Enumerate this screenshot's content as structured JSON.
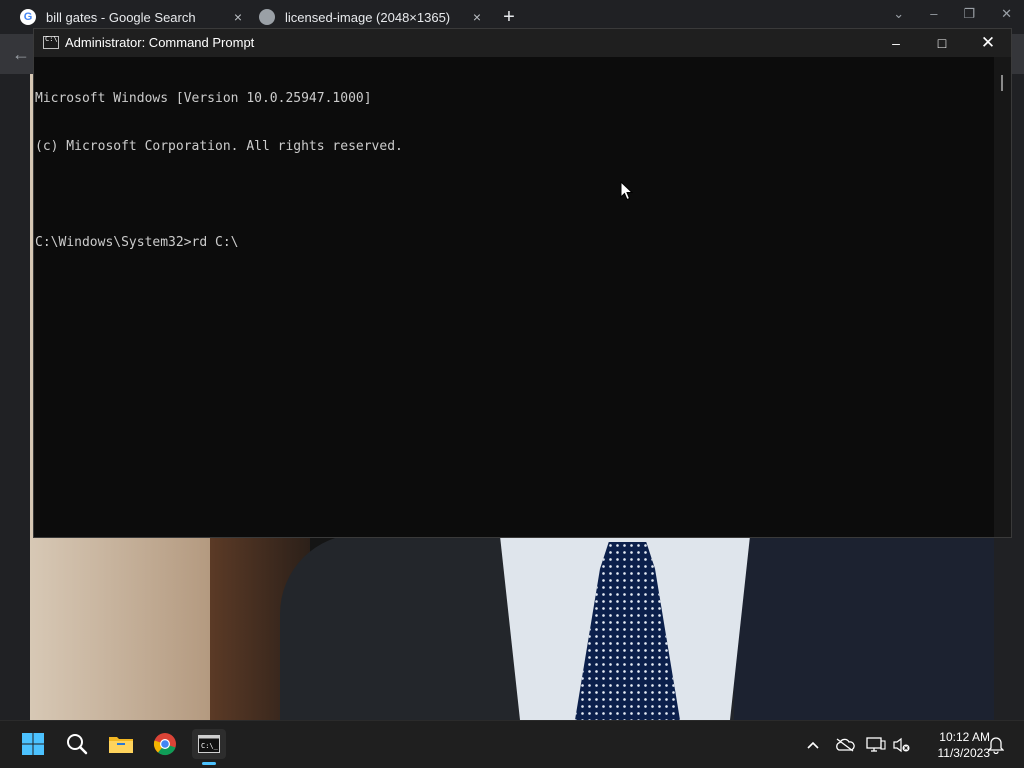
{
  "browser": {
    "tabs": [
      {
        "label": "bill gates - Google Search",
        "close": "×"
      },
      {
        "label": "licensed-image (2048×1365)",
        "close": "×"
      }
    ],
    "new_tab": "+"
  },
  "cmd": {
    "title": "Administrator: Command Prompt",
    "lines": [
      "Microsoft Windows [Version 10.0.25947.1000]",
      "(c) Microsoft Corporation. All rights reserved.",
      "",
      "C:\\Windows\\System32>rd C:\\"
    ],
    "minimize": "–",
    "maximize": "□",
    "close": "✕"
  },
  "taskbar": {
    "pinned": [
      "start-icon",
      "search-icon",
      "file-explorer-icon",
      "chrome-icon",
      "command-prompt-icon"
    ],
    "tray": [
      "chevron-up-icon",
      "onedrive-offline-icon",
      "network-icon",
      "volume-muted-icon"
    ],
    "time": "10:12 AM",
    "date": "11/3/2023"
  },
  "colors": {
    "console_bg": "#0c0c0c",
    "console_text": "#cccccc",
    "taskbar_bg": "#1f1f1f",
    "accent": "#4cc2ff"
  }
}
